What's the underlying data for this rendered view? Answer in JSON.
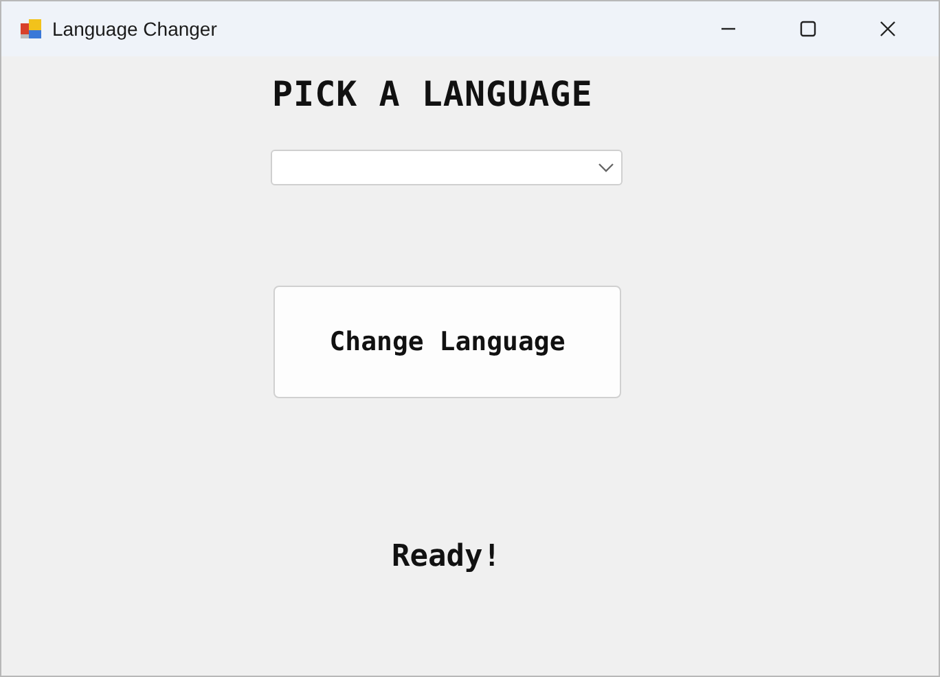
{
  "window": {
    "title": "Language Changer"
  },
  "heading": "PICK A LANGUAGE",
  "language_dropdown": {
    "value_empty": true
  },
  "change_button": {
    "label": "Change Language"
  },
  "status": "Ready!"
}
